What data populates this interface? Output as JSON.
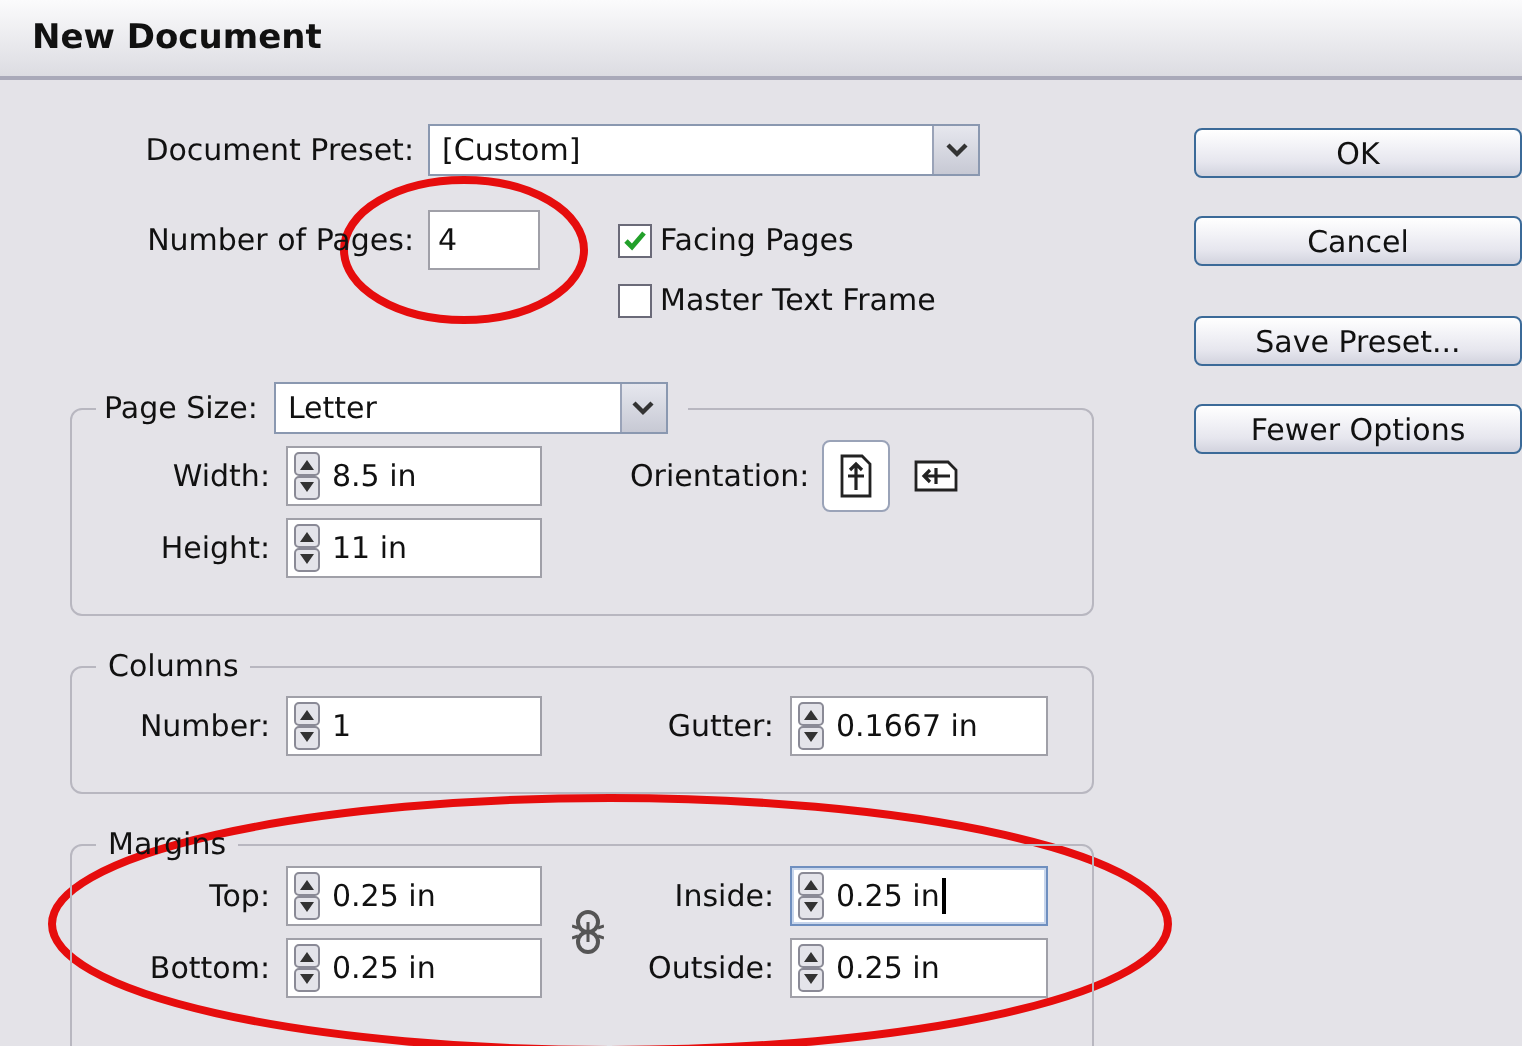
{
  "window": {
    "title": "New Document"
  },
  "document_preset": {
    "label": "Document Preset:",
    "value": "[Custom]"
  },
  "number_of_pages": {
    "label": "Number of Pages:",
    "value": "4"
  },
  "checkboxes": [
    {
      "label": "Facing Pages",
      "checked": true
    },
    {
      "label": "Master Text Frame",
      "checked": false
    }
  ],
  "page_size": {
    "label": "Page Size:",
    "value": "Letter",
    "fields": [
      {
        "label": "Width:",
        "value": "8.5 in"
      },
      {
        "label": "Height:",
        "value": "11 in"
      }
    ],
    "orientation": {
      "label": "Orientation:",
      "options": [
        {
          "kind": "portrait",
          "selected": true
        },
        {
          "kind": "landscape",
          "selected": false
        }
      ]
    }
  },
  "columns": {
    "title": "Columns",
    "fields": [
      {
        "label": "Number:",
        "value": "1"
      },
      {
        "label": "Gutter:",
        "value": "0.1667 in"
      }
    ]
  },
  "margins": {
    "title": "Margins",
    "fields": [
      {
        "label": "Top:",
        "value": "0.25 in",
        "focused": false
      },
      {
        "label": "Inside:",
        "value": "0.25 in",
        "focused": true
      },
      {
        "label": "Bottom:",
        "value": "0.25 in",
        "focused": false
      },
      {
        "label": "Outside:",
        "value": "0.25 in",
        "focused": false
      }
    ]
  },
  "buttons": [
    "OK",
    "Cancel",
    "Save Preset...",
    "Fewer Options"
  ],
  "annotations": [
    {
      "kind": "ellipse"
    },
    {
      "kind": "ellipse"
    }
  ]
}
